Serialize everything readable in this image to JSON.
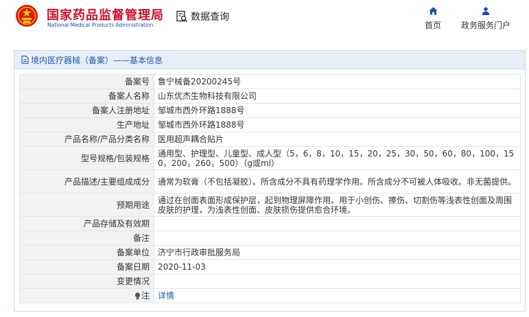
{
  "header": {
    "title_zh": "国家药品监督管理局",
    "title_en": "National Medical Products Administration",
    "query_label": "数据查询",
    "nav": [
      {
        "label": "首页",
        "icon": "home-icon"
      },
      {
        "label": "政务服务门户",
        "icon": "user-icon"
      }
    ]
  },
  "panel": {
    "title": "境内医疗器械（备案）——基本信息"
  },
  "rows": [
    {
      "label": "备案号",
      "value": "鲁宁械备20200245号"
    },
    {
      "label": "备案人名称",
      "value": "山东优杰生物科技有限公司"
    },
    {
      "label": "备案人注册地址",
      "value": "邹城市西外环路1888号"
    },
    {
      "label": "生产地址",
      "value": "邹城市西外环路1888号"
    },
    {
      "label": "产品名称/产品分类名称",
      "value": "医用超声耦合贴片"
    },
    {
      "label": "型号规格/包装规格",
      "value": "通用型、护理型、儿童型、成人型（5，6，8，10，15，20，25，30，50，60，80，100，150，200，260，500）（g或ml）"
    },
    {
      "label": "产品描述/主要组成成分",
      "value": "通常为软膏（不包括凝胶）。所含成分不具有药理学作用。所含成分不可被人体吸收。非无菌提供。"
    },
    {
      "label": "预期用途",
      "value": "通过在创面表面形成保护层，起到物理屏障作用。用于小创伤、擦伤、切割伤等浅表性创面及周围皮肤的护理，为浅表性创面、皮肤损伤提供愈合环境。"
    },
    {
      "label": "产品存储及有效期",
      "value": ""
    },
    {
      "label": "备注",
      "value": ""
    },
    {
      "label": "备案单位",
      "value": "济宁市行政审批服务局"
    },
    {
      "label": "备案日期",
      "value": "2020-11-03"
    },
    {
      "label": "变更情况",
      "value": ""
    },
    {
      "label": "注",
      "value": "详情"
    }
  ],
  "colors": {
    "brand_red": "#c8102e",
    "brand_blue": "#1e4fa3",
    "link_blue": "#1f5aa6",
    "label_bg": "#f2f2f2"
  }
}
